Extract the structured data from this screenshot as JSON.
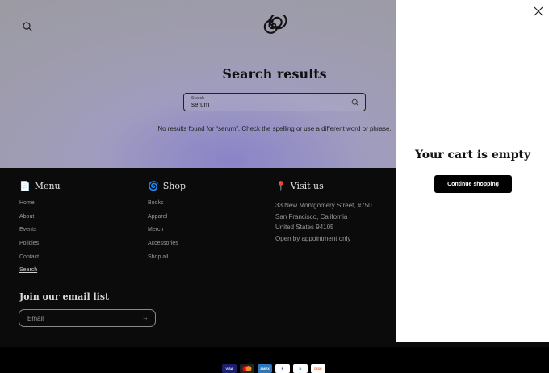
{
  "header": {
    "logo_icon": "spiral-logo-icon",
    "search_icon": "search-icon"
  },
  "main": {
    "title": "Search results",
    "search": {
      "label": "Search",
      "value": "serum",
      "icon": "search-icon"
    },
    "no_results": "No results found for “serum”. Check the spelling or use a different word or phrase."
  },
  "footer": {
    "menu": {
      "emoji": "📄",
      "title": "Menu",
      "items": [
        "Home",
        "About",
        "Events",
        "Policies",
        "Contact",
        "Search"
      ]
    },
    "shop": {
      "emoji": "🌀",
      "title": "Shop",
      "items": [
        "Books",
        "Apparel",
        "Merch",
        "Accessories",
        "Shop all"
      ]
    },
    "visit": {
      "emoji": "📍",
      "title": "Visit us",
      "lines": [
        "33 New Montgomery Street, #750",
        "San Francisco, California",
        "United States 94105",
        "Open by appointment only"
      ]
    },
    "newsletter": {
      "title": "Join our email list",
      "placeholder": "Email",
      "submit_arrow": "→"
    },
    "payments": [
      {
        "label": "VISA",
        "bg": "#1a1f71",
        "fg": "#ffffff"
      },
      {
        "label": "MC",
        "bg": "#222222",
        "fg": "#ffffff"
      },
      {
        "label": "AMEX",
        "bg": "#2e77bc",
        "fg": "#ffffff"
      },
      {
        "label": "P",
        "bg": "#ffffff",
        "fg": "#003087"
      },
      {
        "label": "D",
        "bg": "#ffffff",
        "fg": "#0079be"
      },
      {
        "label": "DISC",
        "bg": "#ffffff",
        "fg": "#e55c20"
      }
    ]
  },
  "cart_drawer": {
    "title": "Your cart is empty",
    "continue_label": "Continue shopping",
    "close_icon": "close-icon"
  }
}
